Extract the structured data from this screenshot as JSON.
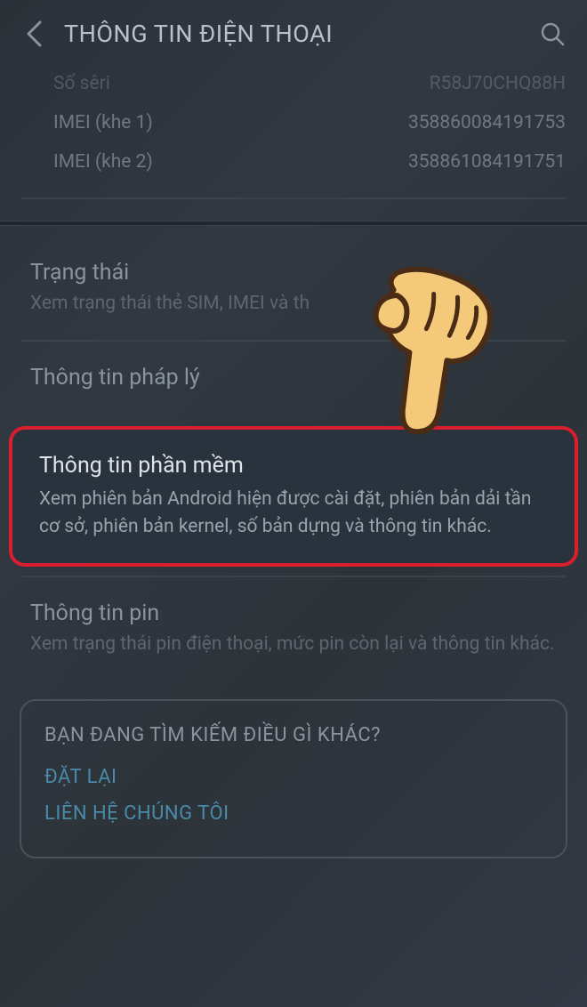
{
  "header": {
    "title": "THÔNG TIN ĐIỆN THOẠI"
  },
  "deviceInfo": {
    "serial": {
      "label": "Số sêri",
      "value": "R58J70CHQ88H"
    },
    "imei1": {
      "label": "IMEI (khe 1)",
      "value": "358860084191753"
    },
    "imei2": {
      "label": "IMEI (khe 2)",
      "value": "358861084191751"
    }
  },
  "items": {
    "status": {
      "title": "Trạng thái",
      "desc": "Xem trạng thái thẻ SIM, IMEI và th"
    },
    "legal": {
      "title": "Thông tin pháp lý"
    },
    "software": {
      "title": "Thông tin phần mềm",
      "desc": "Xem phiên bản Android hiện được cài đặt, phiên bản dải tần cơ sở, phiên bản kernel, số bản dựng và thông tin khác."
    },
    "battery": {
      "title": "Thông tin pin",
      "desc": "Xem trạng thái pin điện thoại, mức pin còn lại và thông tin khác."
    }
  },
  "bottom": {
    "heading": "BẠN ĐANG TÌM KIẾM ĐIỀU GÌ KHÁC?",
    "reset": "ĐẶT LẠI",
    "contact": "LIÊN HỆ CHÚNG TÔI"
  }
}
